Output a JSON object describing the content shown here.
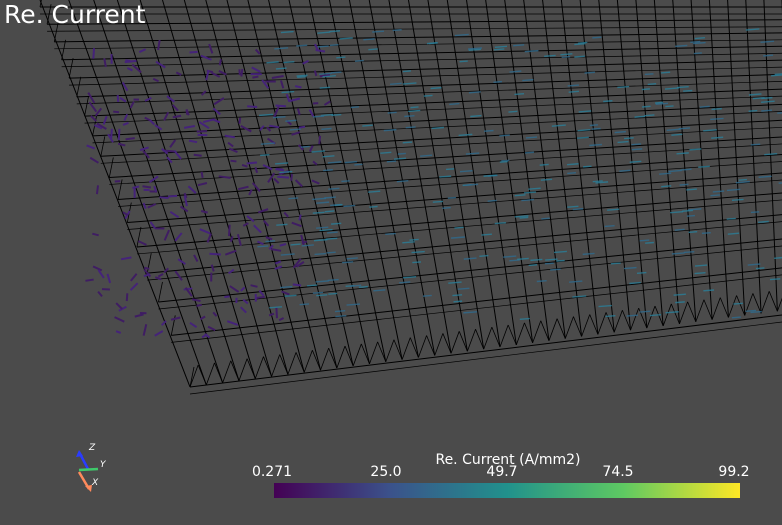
{
  "viewer": {
    "title": "Re. Current"
  },
  "colorbar": {
    "title": "Re. Current (A/mm2)",
    "labels": [
      "0.271",
      "25.0",
      "49.7",
      "74.5",
      "99.2"
    ],
    "colormap": [
      "#440154",
      "#3b528b",
      "#21918c",
      "#5ec962",
      "#fde725"
    ]
  },
  "orientation_axes": {
    "z_label": "Z",
    "y_label": "Y",
    "x_label": "X",
    "colors": {
      "z": "#2a3cff",
      "y": "#3ec96a",
      "x": "#ff8a5c"
    }
  },
  "background": "#4b4b4b",
  "mesh_color": "#000000",
  "glyph_colors": [
    "#3f1d63",
    "#45237a",
    "#2f6b8e",
    "#2a7f99"
  ]
}
